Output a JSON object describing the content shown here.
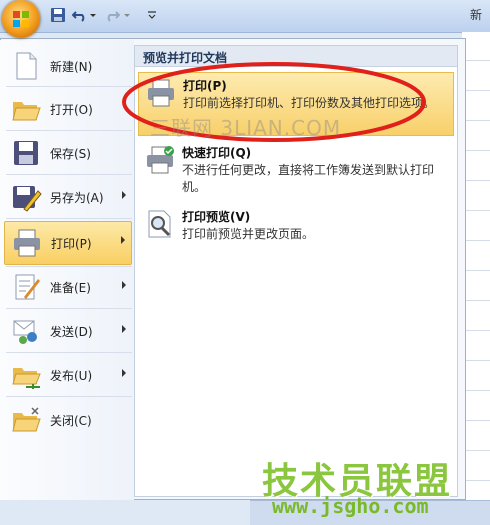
{
  "titlebar": {
    "right_label": "新"
  },
  "left_menu": [
    {
      "label": "新建(N)",
      "icon": "new-document-icon",
      "arrow": false
    },
    {
      "label": "打开(O)",
      "icon": "open-folder-icon",
      "arrow": false
    },
    {
      "label": "保存(S)",
      "icon": "save-disk-icon",
      "arrow": false
    },
    {
      "label": "另存为(A)",
      "icon": "save-as-icon",
      "arrow": true
    },
    {
      "label": "打印(P)",
      "icon": "printer-icon",
      "arrow": true,
      "selected": true
    },
    {
      "label": "准备(E)",
      "icon": "prepare-icon",
      "arrow": true
    },
    {
      "label": "发送(D)",
      "icon": "send-icon",
      "arrow": true
    },
    {
      "label": "发布(U)",
      "icon": "publish-icon",
      "arrow": true
    },
    {
      "label": "关闭(C)",
      "icon": "close-folder-icon",
      "arrow": false
    }
  ],
  "submenu": {
    "header": "预览并打印文档",
    "items": [
      {
        "title": "打印(P)",
        "desc": "打印前选择打印机、打印份数及其他打印选项。",
        "icon": "printer-icon"
      },
      {
        "title": "快速打印(Q)",
        "desc": "不进行任何更改，直接将工作簿发送到默认打印机。",
        "icon": "quick-print-icon"
      },
      {
        "title": "打印预览(V)",
        "desc": "打印前预览并更改页面。",
        "icon": "print-preview-icon"
      }
    ]
  },
  "watermarks": {
    "middle": "三联网 3LIAN.COM",
    "brand": "技术员联盟",
    "url": "www.jsgho.com"
  },
  "colors": {
    "accent_highlight": "#f9cf63",
    "annotation_red": "#e0201a",
    "brand_green": "#8bc63f"
  }
}
